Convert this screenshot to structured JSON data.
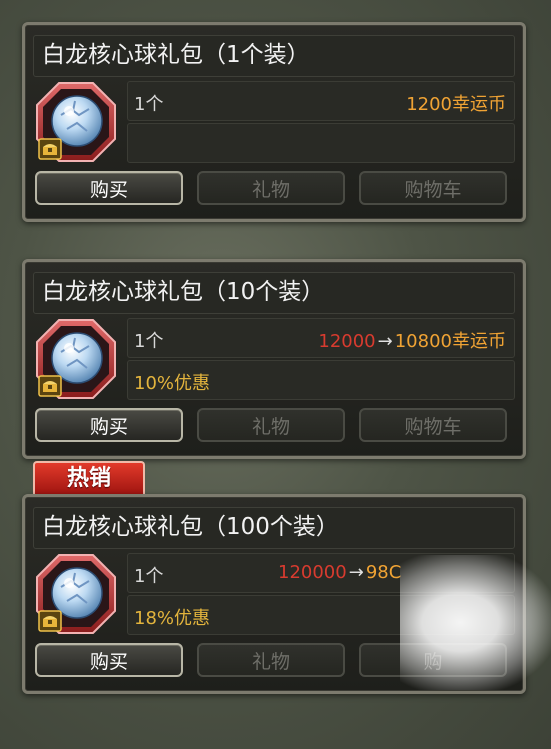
{
  "packs": [
    {
      "title": "白龙核心球礼包（1个装）",
      "qty": "1个",
      "price_old": "",
      "arrow": "",
      "price_new": "1200幸运币",
      "discount": "",
      "buy_label": "购买",
      "gift_label": "礼物",
      "cart_label": "购物车"
    },
    {
      "title": "白龙核心球礼包（10个装）",
      "qty": "1个",
      "price_old": "12000",
      "arrow": "→",
      "price_new": "10800幸运币",
      "discount": "10%优惠",
      "buy_label": "购买",
      "gift_label": "礼物",
      "cart_label": "购物车"
    },
    {
      "title": "白龙核心球礼包（100个装）",
      "qty": "1个",
      "price_old": "120000",
      "arrow": "→",
      "price_new": "98C",
      "discount": "18%优惠",
      "buy_label": "购买",
      "gift_label": "礼物",
      "cart_label": "购"
    }
  ],
  "hot_tag": "热销",
  "icons": {
    "item": "white-dragon-core-orb-icon",
    "chest_badge": "treasure-chest-icon"
  },
  "colors": {
    "old_price": "#d83b2f",
    "new_price": "#f0a334",
    "discount": "#e3b43d",
    "hot_tag": "#c8231a"
  }
}
